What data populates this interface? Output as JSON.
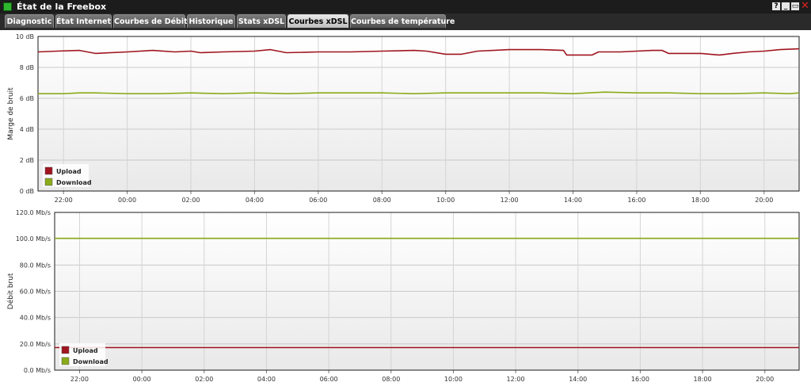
{
  "window": {
    "title": "État de la Freebox",
    "buttons": [
      "?",
      "_",
      "▭",
      "✕"
    ]
  },
  "tabs": [
    {
      "label": "Diagnostic",
      "active": false
    },
    {
      "label": "État Internet",
      "active": false
    },
    {
      "label": "Courbes de Débit",
      "active": false
    },
    {
      "label": "Historique",
      "active": false
    },
    {
      "label": "Stats xDSL",
      "active": false
    },
    {
      "label": "Courbes xDSL",
      "active": true
    },
    {
      "label": "Courbes de température",
      "active": false
    }
  ],
  "colors": {
    "upload": "#a0151f",
    "download": "#8aab1a"
  },
  "chart_data": [
    {
      "type": "line",
      "ylabel": "Marge de bruit",
      "ylim": [
        0,
        10
      ],
      "yticks": [
        "0 dB",
        "2 dB",
        "4 dB",
        "6 dB",
        "8 dB",
        "10 dB"
      ],
      "xlim": [
        21.2,
        45.1
      ],
      "xticks": [
        {
          "v": 22,
          "label": "22:00"
        },
        {
          "v": 24,
          "label": "00:00"
        },
        {
          "v": 26,
          "label": "02:00"
        },
        {
          "v": 28,
          "label": "04:00"
        },
        {
          "v": 30,
          "label": "06:00"
        },
        {
          "v": 32,
          "label": "08:00"
        },
        {
          "v": 34,
          "label": "10:00"
        },
        {
          "v": 36,
          "label": "12:00"
        },
        {
          "v": 38,
          "label": "14:00"
        },
        {
          "v": 40,
          "label": "16:00"
        },
        {
          "v": 42,
          "label": "18:00"
        },
        {
          "v": 44,
          "label": "20:00"
        }
      ],
      "legend": "bottom-left",
      "series": [
        {
          "name": "Upload",
          "color": "#a0151f",
          "x": [
            21.2,
            21.8,
            22.5,
            23.0,
            24.0,
            24.8,
            25.5,
            26.0,
            26.3,
            27.0,
            28.0,
            28.5,
            29.0,
            30.0,
            31.0,
            32.0,
            33.0,
            33.4,
            34.0,
            34.5,
            35.0,
            36.0,
            37.0,
            37.7,
            37.8,
            38.0,
            38.6,
            38.8,
            39.5,
            40.0,
            40.5,
            40.8,
            41.0,
            41.5,
            42.0,
            42.6,
            43.0,
            43.5,
            44.0,
            44.5,
            45.1
          ],
          "y": [
            9.0,
            9.05,
            9.1,
            8.9,
            9.0,
            9.1,
            9.0,
            9.05,
            8.95,
            9.0,
            9.05,
            9.15,
            8.95,
            9.0,
            9.0,
            9.05,
            9.1,
            9.05,
            8.85,
            8.85,
            9.05,
            9.15,
            9.15,
            9.1,
            8.8,
            8.8,
            8.8,
            9.0,
            9.0,
            9.05,
            9.1,
            9.1,
            8.9,
            8.9,
            8.9,
            8.8,
            8.9,
            9.0,
            9.05,
            9.15,
            9.2
          ]
        },
        {
          "name": "Download",
          "color": "#8aab1a",
          "x": [
            21.2,
            22.0,
            22.5,
            23.0,
            24.0,
            25.0,
            26.0,
            27.0,
            28.0,
            29.0,
            30.0,
            31.0,
            32.0,
            33.0,
            34.0,
            35.0,
            36.0,
            37.0,
            38.0,
            39.0,
            40.0,
            41.0,
            42.0,
            43.0,
            44.0,
            44.8,
            45.1
          ],
          "y": [
            6.3,
            6.3,
            6.35,
            6.35,
            6.3,
            6.3,
            6.35,
            6.3,
            6.35,
            6.3,
            6.35,
            6.35,
            6.35,
            6.3,
            6.35,
            6.35,
            6.35,
            6.35,
            6.3,
            6.4,
            6.35,
            6.35,
            6.3,
            6.3,
            6.35,
            6.3,
            6.35
          ]
        }
      ]
    },
    {
      "type": "line",
      "ylabel": "Débit brut",
      "ylim": [
        0,
        120
      ],
      "yticks": [
        "0.0 Mb/s",
        "20.0 Mb/s",
        "40.0 Mb/s",
        "60.0 Mb/s",
        "80.0 Mb/s",
        "100.0 Mb/s",
        "120.0 Mb/s"
      ],
      "xlim": [
        21.2,
        45.1
      ],
      "xticks": [
        {
          "v": 22,
          "label": "22:00"
        },
        {
          "v": 24,
          "label": "00:00"
        },
        {
          "v": 26,
          "label": "02:00"
        },
        {
          "v": 28,
          "label": "04:00"
        },
        {
          "v": 30,
          "label": "06:00"
        },
        {
          "v": 32,
          "label": "08:00"
        },
        {
          "v": 34,
          "label": "10:00"
        },
        {
          "v": 36,
          "label": "12:00"
        },
        {
          "v": 38,
          "label": "14:00"
        },
        {
          "v": 40,
          "label": "16:00"
        },
        {
          "v": 42,
          "label": "18:00"
        },
        {
          "v": 44,
          "label": "20:00"
        }
      ],
      "legend": "bottom-left",
      "series": [
        {
          "name": "Upload",
          "color": "#a0151f",
          "x": [
            21.2,
            45.1
          ],
          "y": [
            17.2,
            17.2
          ]
        },
        {
          "name": "Download",
          "color": "#8aab1a",
          "x": [
            21.2,
            45.1
          ],
          "y": [
            100.3,
            100.3
          ]
        }
      ]
    }
  ]
}
